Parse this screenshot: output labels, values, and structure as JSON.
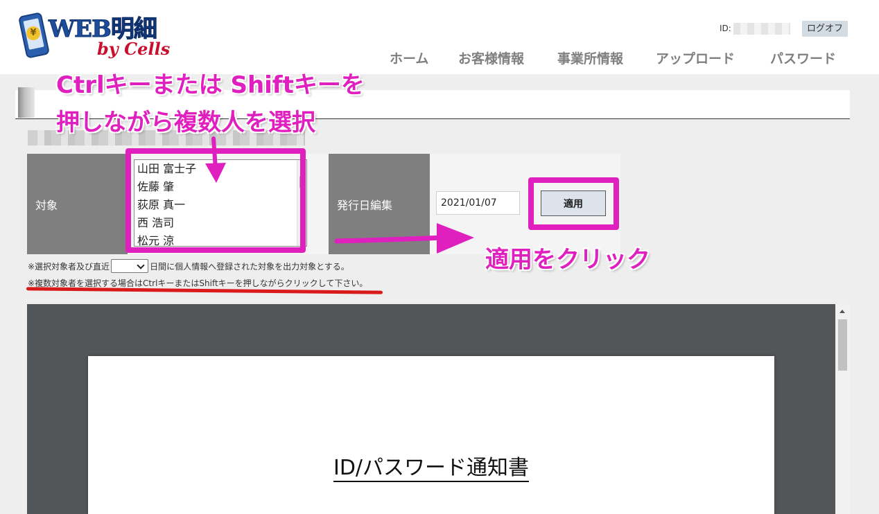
{
  "header": {
    "logo": {
      "title": "WEB明細",
      "subtitle": "by Cells",
      "coin_icon": "yen-coin-icon"
    },
    "id_label": "ID:",
    "logoff_label": "ログオフ",
    "nav": [
      {
        "label": "ホーム"
      },
      {
        "label": "お客様情報"
      },
      {
        "label": "事業所情報"
      },
      {
        "label": "アップロード"
      },
      {
        "label": "パスワード"
      }
    ]
  },
  "form": {
    "target_label": "対象",
    "people": [
      {
        "name": "山田 富士子"
      },
      {
        "name": "佐藤 肇"
      },
      {
        "name": "荻原 真一"
      },
      {
        "name": "西 浩司"
      },
      {
        "name": "松元 涼"
      }
    ],
    "issue_date_label": "発行日編集",
    "issue_date_value": "2021/01/07",
    "apply_label": "適用"
  },
  "notes": {
    "note1_pre": "※選択対象者及び直近",
    "note1_post": "日間に個人情報へ登録された対象を出力対象とする。",
    "note2": "※複数対象者を選択する場合はCtrlキーまたはShiftキーを押しながらクリックして下さい。"
  },
  "viewer": {
    "doc_title": "ID/パスワード通知書"
  },
  "annotations": {
    "line1": "Ctrlキーまたは Shiftキーを",
    "line2": "押しながら複数人を選択",
    "apply_hint": "適用をクリック",
    "color": "#e01fbf"
  }
}
